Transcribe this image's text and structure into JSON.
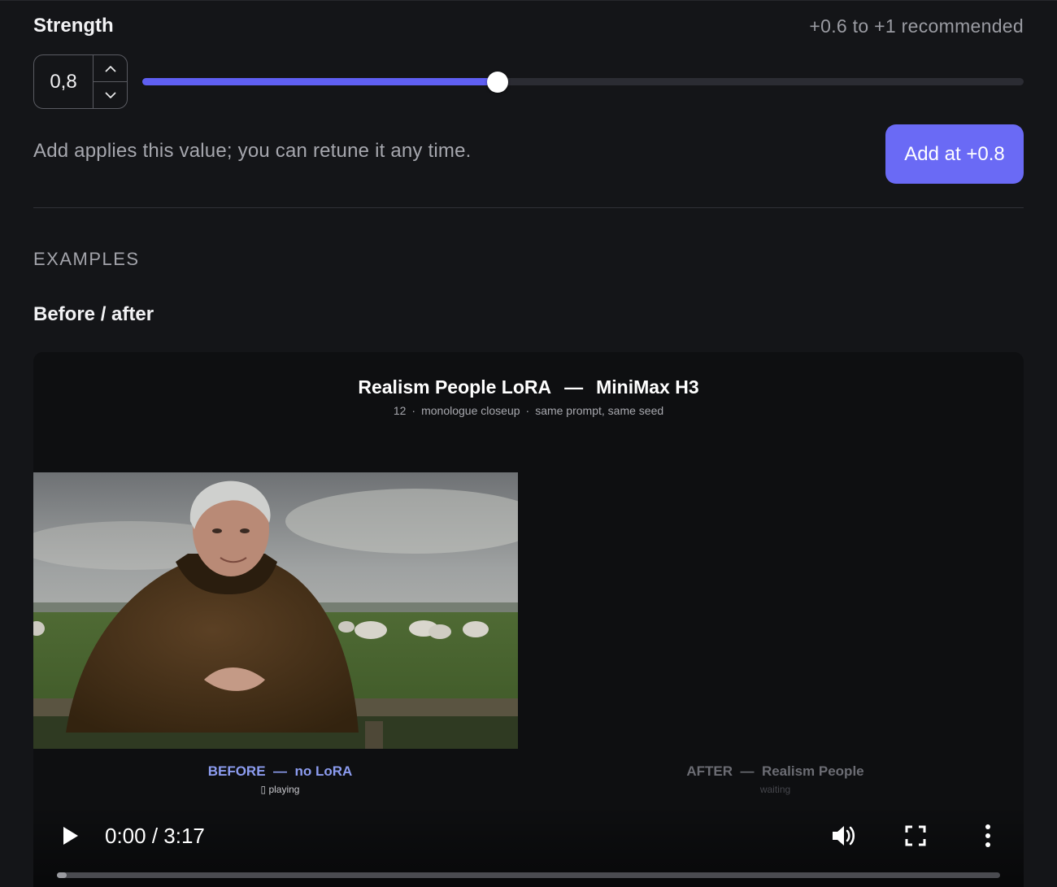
{
  "strength": {
    "label": "Strength",
    "recommended": "+0.6 to +1 recommended",
    "value_display": "0,8",
    "value": 0.8,
    "min": -1,
    "max": 1,
    "fill_color": "#5f5ff2"
  },
  "apply": {
    "hint": "Add applies this value; you can retune it any time.",
    "button_label": "Add at +0.8",
    "button_color": "#6a6af5"
  },
  "examples": {
    "section_label": "EXAMPLES",
    "subheading": "Before / after",
    "card": {
      "title_left": "Realism People LoRA",
      "title_sep": "—",
      "title_right": "MiniMax H3",
      "meta": [
        "12",
        "monologue closeup",
        "same prompt, same seed"
      ],
      "before": {
        "label": "BEFORE",
        "sep": "—",
        "desc": "no LoRA",
        "status": "▯ playing"
      },
      "after": {
        "label": "AFTER",
        "sep": "—",
        "desc": "Realism People",
        "status": "waiting"
      }
    }
  },
  "player": {
    "time": "0:00 / 3:17",
    "progress": 0.01,
    "icons": [
      "play-icon",
      "volume-icon",
      "fullscreen-icon",
      "more-vert-icon"
    ]
  }
}
